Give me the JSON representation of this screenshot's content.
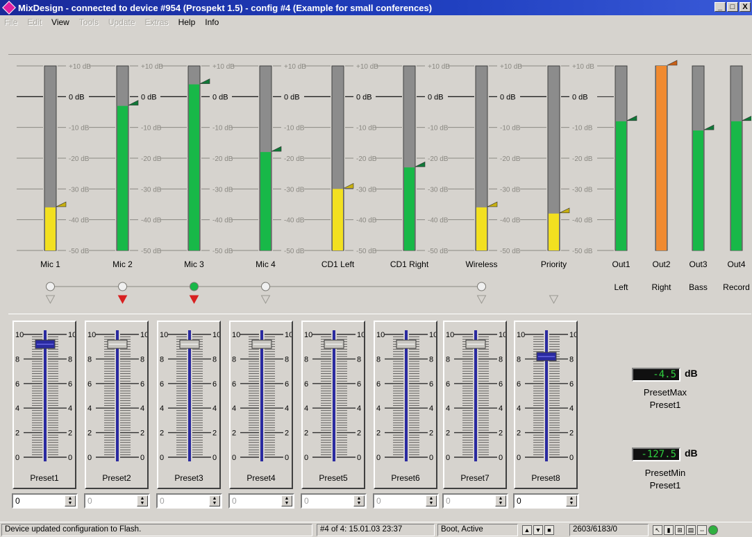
{
  "window": {
    "title": "MixDesign - connected to device #954 (Prospekt 1.5)  -  config #4 (Example for small conferences)",
    "minimize": "_",
    "maximize": "□",
    "close": "X"
  },
  "menu": [
    {
      "label": "File",
      "enabled": false
    },
    {
      "label": "Edit",
      "enabled": false
    },
    {
      "label": "View",
      "enabled": true
    },
    {
      "label": "Tools",
      "enabled": false
    },
    {
      "label": "Update",
      "enabled": false
    },
    {
      "label": "Extras",
      "enabled": false
    },
    {
      "label": "Help",
      "enabled": true
    },
    {
      "label": "Info",
      "enabled": true
    }
  ],
  "scale_labels": [
    "+10 dB",
    "0 dB",
    "-10 dB",
    "-20 dB",
    "-30 dB",
    "-40 dB",
    "-50 dB"
  ],
  "input_channels": [
    {
      "name": "Mic 1",
      "level_db": -36,
      "color": "#f2e020",
      "routed": false,
      "triangle": "outline"
    },
    {
      "name": "Mic 2",
      "level_db": -3,
      "color": "#18b848",
      "routed": false,
      "triangle": "red"
    },
    {
      "name": "Mic 3",
      "level_db": 4,
      "color": "#18b848",
      "routed": true,
      "triangle": "red"
    },
    {
      "name": "Mic 4",
      "level_db": -18,
      "color": "#18b848",
      "routed": false,
      "triangle": "outline"
    },
    {
      "name": "CD1 Left",
      "level_db": -30,
      "color": "#f2e020",
      "routed": null,
      "triangle": null
    },
    {
      "name": "CD1 Right",
      "level_db": -23,
      "color": "#18b848",
      "routed": null,
      "triangle": null
    },
    {
      "name": "Wireless",
      "level_db": -36,
      "color": "#f2e020",
      "routed": false,
      "triangle": "outline"
    },
    {
      "name": "Priority",
      "level_db": -38,
      "color": "#f2e020",
      "routed": null,
      "triangle": "outline"
    }
  ],
  "output_channels": [
    {
      "name": "Out1",
      "sub": "Left",
      "level_db": -8,
      "color": "#18b848"
    },
    {
      "name": "Out2",
      "sub": "Right",
      "level_db": 10,
      "color": "#f08a30"
    },
    {
      "name": "Out3",
      "sub": "Bass",
      "level_db": -11,
      "color": "#18b848"
    },
    {
      "name": "Out4",
      "sub": "Record",
      "level_db": -8,
      "color": "#18b848"
    }
  ],
  "presets": [
    {
      "label": "Preset1",
      "value": 9.2,
      "active": true,
      "spin": "0",
      "spin_enabled": true
    },
    {
      "label": "Preset2",
      "value": 9.2,
      "active": false,
      "spin": "0",
      "spin_enabled": false
    },
    {
      "label": "Preset3",
      "value": 9.2,
      "active": false,
      "spin": "0",
      "spin_enabled": false
    },
    {
      "label": "Preset4",
      "value": 9.2,
      "active": false,
      "spin": "0",
      "spin_enabled": false
    },
    {
      "label": "Preset5",
      "value": 9.2,
      "active": false,
      "spin": "0",
      "spin_enabled": false
    },
    {
      "label": "Preset6",
      "value": 9.2,
      "active": false,
      "spin": "0",
      "spin_enabled": false
    },
    {
      "label": "Preset7",
      "value": 9.2,
      "active": false,
      "spin": "0",
      "spin_enabled": false
    },
    {
      "label": "Preset8",
      "value": 8.2,
      "active": true,
      "spin": "0",
      "spin_enabled": true
    }
  ],
  "slider_scale": [
    "10",
    "8",
    "6",
    "4",
    "2",
    "0"
  ],
  "preset_max": {
    "value": "-4.5",
    "unit": "dB",
    "caption1": "PresetMax",
    "caption2": "Preset1"
  },
  "preset_min": {
    "value": "-127.5",
    "unit": "dB",
    "caption1": "PresetMin",
    "caption2": "Preset1"
  },
  "status": {
    "message": "Device updated configuration to Flash.",
    "config": "#4 of 4: 15.01.03 23:37",
    "mode": "Boot, Active",
    "counter": "2603/6183/0"
  },
  "colors": {
    "meter_bg": "#8c8c8c",
    "green": "#18b848",
    "yellow": "#f2e020",
    "orange": "#f08a30",
    "slider_blue": "#2a2aa0",
    "routing_red": "#d82020"
  }
}
